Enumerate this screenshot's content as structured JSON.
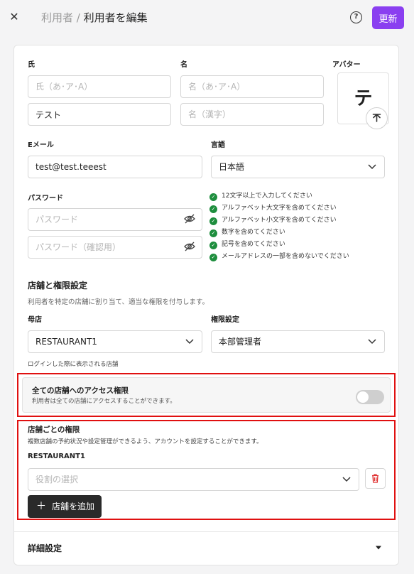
{
  "header": {
    "close_icon": "close-icon",
    "breadcrumb_parent": "利用者",
    "breadcrumb_sep": " / ",
    "breadcrumb_current": "利用者を編集",
    "help_icon": "help-circle-icon",
    "update_label": "更新",
    "update_color": "#8a3ff0"
  },
  "form": {
    "last_name_label": "氏",
    "last_name_kana_placeholder": "氏（あ･ア･A）",
    "last_name_value": "テスト",
    "first_name_label": "名",
    "first_name_kana_placeholder": "名（あ･ア･A）",
    "first_name_kanji_placeholder": "名（漢字）",
    "avatar_label": "アバター",
    "avatar_initial": "テ",
    "email_label": "Eメール",
    "email_value": "test@test.teeest",
    "language_label": "言語",
    "language_value": "日本語",
    "password_label": "パスワード",
    "password_placeholder": "パスワード",
    "password_confirm_placeholder": "パスワード（確認用）",
    "password_rules": [
      "12文字以上で入力してください",
      "アルファベット大文字を含めてください",
      "アルファベット小文字を含めてください",
      "数字を含めてください",
      "記号を含めてください",
      "メールアドレスの一部を含めないでください"
    ],
    "rule_check_color": "#1e8e3e"
  },
  "store_section": {
    "title": "店舗と権限設定",
    "subtitle": "利用者を特定の店舗に割り当て、適当な権限を付与します。",
    "home_store_label": "母店",
    "home_store_value": "RESTAURANT1",
    "home_store_hint": "ログインした際に表示される店舗",
    "permission_label": "権限設定",
    "permission_value": "本部管理者",
    "all_access_title": "全ての店舗へのアクセス権限",
    "all_access_desc": "利用者は全ての店舗にアクセスすることができます。",
    "all_access_enabled": false,
    "per_store_title": "店舗ごとの権限",
    "per_store_desc": "複数店舗の予約状況や設定管理ができるよう、アカウントを設定することができます。",
    "store_name": "RESTAURANT1",
    "role_placeholder": "役割の選択",
    "add_store_label": "店舗を追加",
    "add_icon": "plus-icon",
    "trash_icon": "trash-icon",
    "trash_color": "#e03030",
    "highlight_color": "#e01010"
  },
  "details": {
    "label": "詳細設定",
    "caret_icon": "caret-down-icon"
  }
}
